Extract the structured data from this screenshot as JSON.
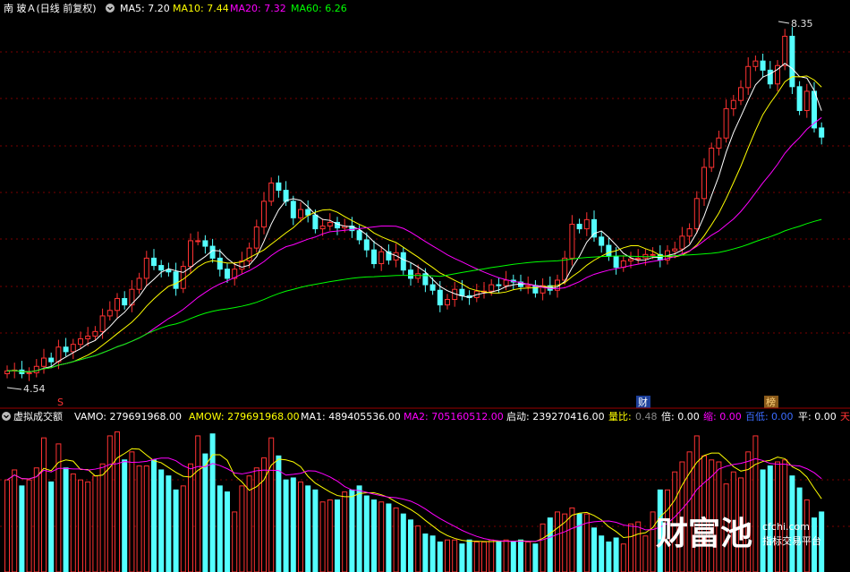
{
  "header": {
    "title": "南 玻Ａ(日线 前复权)",
    "ma_items": [
      {
        "label": "MA5: 7.20",
        "color": "#ffffff"
      },
      {
        "label": "MA10: 7.44",
        "color": "#ffff00"
      },
      {
        "label": "MA20: 7.32",
        "color": "#ff00ff"
      },
      {
        "label": "MA60: 6.26",
        "color": "#00ff00"
      }
    ]
  },
  "annotations": {
    "high_label": "8.35",
    "low_label": "4.54",
    "marker_s": "S",
    "marker_cai": "财",
    "marker_bang": "榜"
  },
  "indicator": {
    "title": "虚拟成交额",
    "items": [
      {
        "label": "VAMO: 279691968.00",
        "color": "#ffffff"
      },
      {
        "label": "AMOW: 279691968.00",
        "color": "#ffff00"
      },
      {
        "label": "MA1: 489405536.00",
        "color": "#ffffff"
      },
      {
        "label": "MA2: 705160512.00",
        "color": "#ff00ff"
      },
      {
        "label": "启动: 239270416.00",
        "color": "#ffffff"
      },
      {
        "label": "量比:",
        "color": "#ffff00"
      },
      {
        "label": "0.48",
        "color": "#888888"
      },
      {
        "label": "倍: 0.00",
        "color": "#ffffff"
      },
      {
        "label": "缩: 0.00",
        "color": "#ff00ff"
      },
      {
        "label": "百低:",
        "color": "#3b6cff"
      },
      {
        "label": "0.00",
        "color": "#3b6cff"
      },
      {
        "label": "平: 0.00",
        "color": "#ffffff"
      },
      {
        "label": "天",
        "color": "#ff3333"
      }
    ]
  },
  "watermark": {
    "brand": "财富池",
    "site": "cfchi.com",
    "slogan": "指标交易平台"
  },
  "colors": {
    "up": "#ff3232",
    "down": "#54ffff",
    "ma5": "#ffffff",
    "ma10": "#ffff00",
    "ma20": "#ff00ff",
    "ma60": "#00ff00",
    "grid": "#7a0000"
  },
  "chart_data": {
    "type": "candlestick",
    "title": "南 玻Ａ(日线 前复权)",
    "ylim": [
      4.4,
      8.5
    ],
    "closes": [
      4.65,
      4.66,
      4.62,
      4.63,
      4.7,
      4.79,
      4.75,
      4.91,
      4.86,
      4.94,
      5.0,
      5.03,
      5.08,
      5.25,
      5.31,
      5.44,
      5.37,
      5.54,
      5.66,
      5.88,
      5.8,
      5.75,
      5.73,
      5.55,
      5.79,
      6.07,
      6.07,
      6.01,
      5.88,
      5.76,
      5.66,
      5.76,
      5.85,
      5.99,
      6.22,
      6.5,
      6.7,
      6.62,
      6.5,
      6.32,
      6.41,
      6.35,
      6.2,
      6.23,
      6.27,
      6.21,
      6.23,
      6.18,
      6.08,
      5.97,
      5.82,
      5.95,
      5.86,
      5.94,
      5.75,
      5.66,
      5.71,
      5.59,
      5.53,
      5.37,
      5.43,
      5.54,
      5.47,
      5.45,
      5.52,
      5.52,
      5.59,
      5.58,
      5.64,
      5.62,
      5.57,
      5.58,
      5.5,
      5.58,
      5.53,
      5.64,
      5.88,
      6.25,
      6.2,
      6.3,
      6.11,
      6.02,
      5.9,
      5.78,
      5.85,
      5.87,
      5.88,
      5.92,
      5.92,
      5.86,
      5.96,
      5.98,
      6.12,
      6.2,
      6.53,
      6.87,
      7.08,
      7.19,
      7.51,
      7.6,
      7.74,
      7.97,
      8.03,
      7.93,
      7.78,
      7.98,
      8.3,
      7.75,
      7.49,
      7.7,
      7.3,
      7.2
    ],
    "volume_series": [
      230,
      255,
      215,
      230,
      260,
      335,
      225,
      320,
      260,
      245,
      230,
      225,
      240,
      270,
      340,
      350,
      280,
      300,
      265,
      265,
      280,
      255,
      240,
      205,
      215,
      270,
      340,
      295,
      345,
      215,
      200,
      150,
      215,
      240,
      260,
      285,
      335,
      290,
      230,
      235,
      225,
      215,
      205,
      175,
      180,
      180,
      200,
      205,
      215,
      190,
      180,
      175,
      170,
      160,
      145,
      130,
      115,
      95,
      90,
      75,
      80,
      80,
      70,
      80,
      75,
      75,
      80,
      75,
      80,
      75,
      80,
      75,
      70,
      120,
      135,
      150,
      145,
      160,
      145,
      145,
      110,
      90,
      75,
      85,
      70,
      120,
      125,
      90,
      150,
      205,
      205,
      250,
      275,
      300,
      340,
      290,
      280,
      275,
      220,
      250,
      235,
      300,
      340,
      255,
      265,
      275,
      280,
      240,
      210,
      180,
      135,
      150
    ]
  }
}
